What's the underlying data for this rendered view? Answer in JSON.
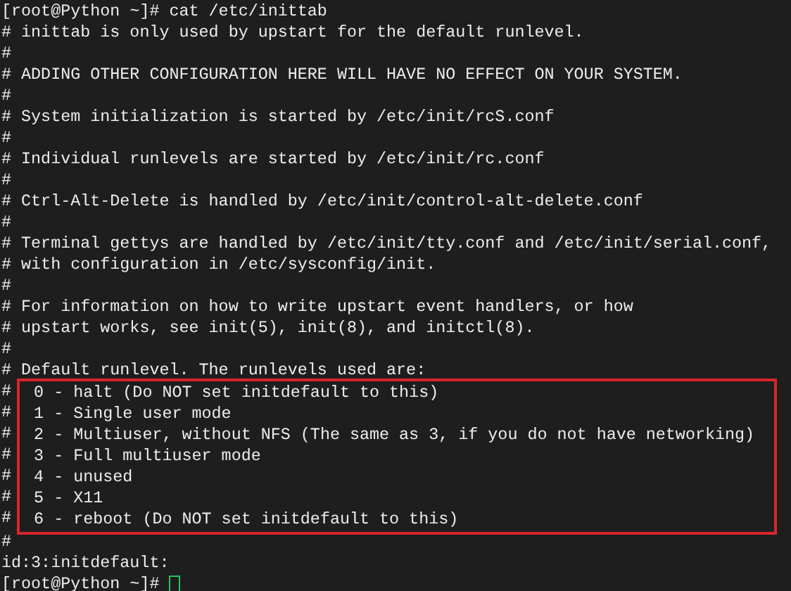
{
  "terminal": {
    "lines": [
      {
        "kind": "line",
        "text": "[root@Python ~]# cat /etc/inittab"
      },
      {
        "kind": "line",
        "text": "# inittab is only used by upstart for the default runlevel."
      },
      {
        "kind": "line",
        "text": "#"
      },
      {
        "kind": "line",
        "text": "# ADDING OTHER CONFIGURATION HERE WILL HAVE NO EFFECT ON YOUR SYSTEM."
      },
      {
        "kind": "line",
        "text": "#"
      },
      {
        "kind": "line",
        "text": "# System initialization is started by /etc/init/rcS.conf"
      },
      {
        "kind": "line",
        "text": "#"
      },
      {
        "kind": "line",
        "text": "# Individual runlevels are started by /etc/init/rc.conf"
      },
      {
        "kind": "line",
        "text": "#"
      },
      {
        "kind": "line",
        "text": "# Ctrl-Alt-Delete is handled by /etc/init/control-alt-delete.conf"
      },
      {
        "kind": "line",
        "text": "#"
      },
      {
        "kind": "line",
        "text": "# Terminal gettys are handled by /etc/init/tty.conf and /etc/init/serial.conf,"
      },
      {
        "kind": "line",
        "text": "# with configuration in /etc/sysconfig/init."
      },
      {
        "kind": "line",
        "text": "#"
      },
      {
        "kind": "line",
        "text": "# For information on how to write upstart event handlers, or how"
      },
      {
        "kind": "line",
        "text": "# upstart works, see init(5), init(8), and initctl(8)."
      },
      {
        "kind": "line",
        "text": "#"
      },
      {
        "kind": "line",
        "text": "# Default runlevel. The runlevels used are:"
      },
      {
        "kind": "highlight",
        "lines": [
          {
            "prefix": "#",
            "text": "  0 - halt (Do NOT set initdefault to this)"
          },
          {
            "prefix": "#",
            "text": "  1 - Single user mode"
          },
          {
            "prefix": "#",
            "text": "  2 - Multiuser, without NFS (The same as 3, if you do not have networking)"
          },
          {
            "prefix": "#",
            "text": "  3 - Full multiuser mode"
          },
          {
            "prefix": "#",
            "text": "  4 - unused"
          },
          {
            "prefix": "#",
            "text": "  5 - X11"
          },
          {
            "prefix": "#",
            "text": "  6 - reboot (Do NOT set initdefault to this)"
          }
        ]
      },
      {
        "kind": "line",
        "text": "#"
      },
      {
        "kind": "line",
        "text": "id:3:initdefault:"
      },
      {
        "kind": "prompt",
        "text": "[root@Python ~]# ",
        "cursor": true
      }
    ]
  }
}
